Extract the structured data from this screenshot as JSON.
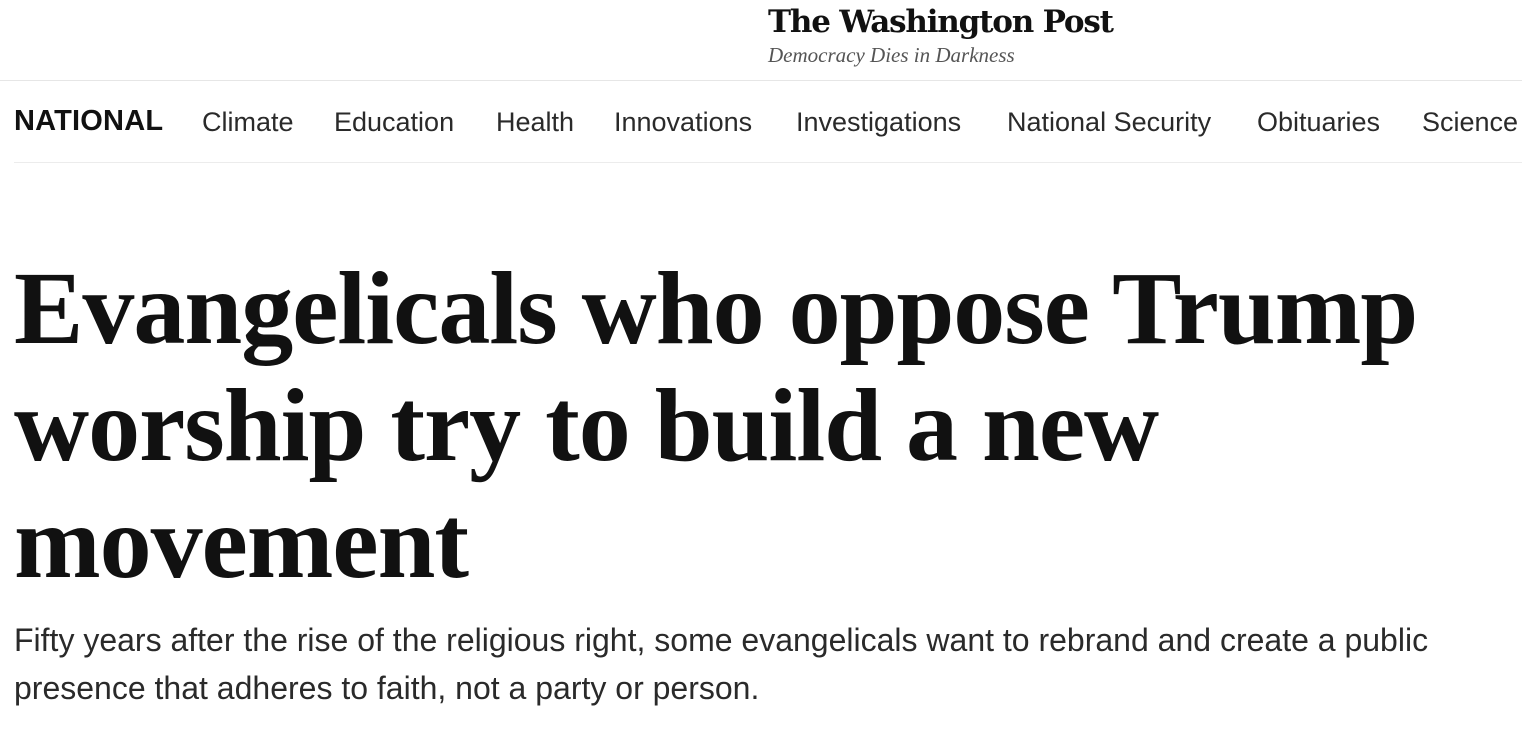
{
  "masthead": {
    "logo_text": "The Washington Post",
    "tagline": "Democracy Dies in Darkness"
  },
  "section_nav": {
    "section_title": "NATIONAL",
    "links": [
      "Climate",
      "Education",
      "Health",
      "Innovations",
      "Investigations",
      "National Security",
      "Obituaries",
      "Science"
    ]
  },
  "article": {
    "headline": "Evangelicals who oppose Trump worship try to build a new movement",
    "dek": "Fifty years after the rise of the religious right, some evangelicals want to rebrand and create a public presence that adheres to faith, not a party or person."
  }
}
